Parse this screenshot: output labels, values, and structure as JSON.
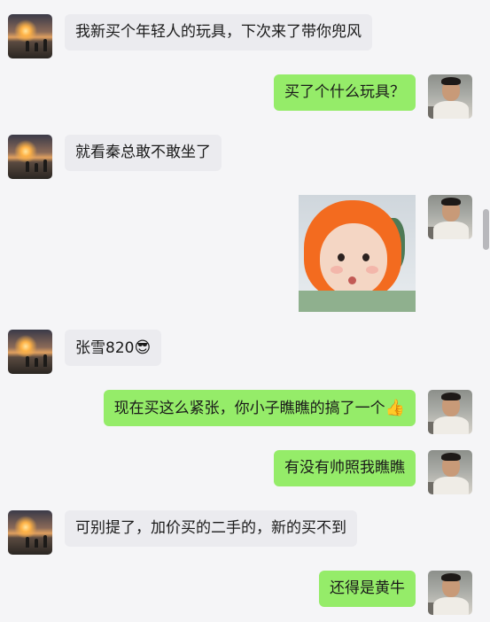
{
  "messages": [
    {
      "side": "in",
      "text": "我新买个年轻人的玩具，下次来了带你兜风",
      "avatar": "sunset-avatar"
    },
    {
      "side": "out",
      "text": "买了个什么玩具？",
      "avatar": "user-avatar"
    },
    {
      "side": "in",
      "text": "就看秦总敢不敢坐了",
      "avatar": "sunset-avatar"
    },
    {
      "side": "out",
      "type": "sticker",
      "avatar": "user-avatar",
      "sticker": "baby-in-orange-hood-sticker"
    },
    {
      "side": "in",
      "text": "张雪820",
      "emoji": "😎",
      "avatar": "sunset-avatar"
    },
    {
      "side": "out",
      "text": "现在买这么紧张，你小子瞧瞧的搞了一个",
      "emoji": "👍",
      "avatar": "user-avatar"
    },
    {
      "side": "out",
      "text": "有没有帅照我瞧瞧",
      "avatar": "user-avatar"
    },
    {
      "side": "in",
      "text": "可别提了，加价买的二手的，新的买不到",
      "avatar": "sunset-avatar"
    },
    {
      "side": "out",
      "text": "还得是黄牛",
      "avatar": "user-avatar"
    }
  ],
  "colors": {
    "background": "#f5f5f7",
    "incoming_bubble": "#ebebef",
    "outgoing_bubble": "#95ec69",
    "text": "#1a1a1a"
  }
}
